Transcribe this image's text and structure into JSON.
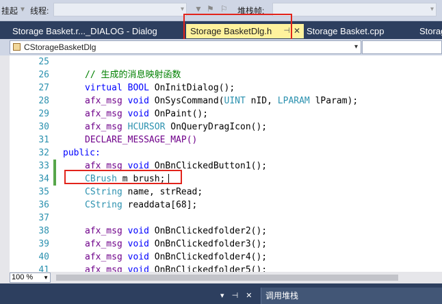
{
  "toolbar": {
    "bookmark_label": "挂起",
    "thread_label": "线程:",
    "stackframe_label": "堆栈帧:"
  },
  "tabs": [
    {
      "label": "Storage Basket.r..._DIALOG - Dialog",
      "active": false
    },
    {
      "label": "Storage BasketDlg.h",
      "active": true
    },
    {
      "label": "Storage Basket.cpp",
      "active": false
    },
    {
      "label": "Storag",
      "active": false
    }
  ],
  "nav": {
    "class_value": "CStorageBasketDlg",
    "member_value": ""
  },
  "code_lines": [
    {
      "n": "25"
    },
    {
      "n": "26",
      "t": "// 生成的消息映射函数"
    },
    {
      "n": "27",
      "t": "virtual BOOL OnInitDialog();"
    },
    {
      "n": "28",
      "t": "afx_msg void OnSysCommand(UINT nID, LPARAM lParam);"
    },
    {
      "n": "29",
      "t": "afx_msg void OnPaint();"
    },
    {
      "n": "30",
      "t": "afx_msg HCURSOR OnQueryDragIcon();"
    },
    {
      "n": "31",
      "t": "DECLARE_MESSAGE_MAP()"
    },
    {
      "n": "32",
      "t": "public:"
    },
    {
      "n": "33",
      "t": "afx_msg void OnBnClickedButton1();"
    },
    {
      "n": "34",
      "t": "CBrush m_brush;"
    },
    {
      "n": "35",
      "t": "CString name, strRead;"
    },
    {
      "n": "36",
      "t": "CString readdata[68];"
    },
    {
      "n": "37"
    },
    {
      "n": "38",
      "t": "afx_msg void OnBnClickedfolder2();"
    },
    {
      "n": "39",
      "t": "afx_msg void OnBnClickedfolder3();"
    },
    {
      "n": "40",
      "t": "afx_msg void OnBnClickedfolder4();"
    },
    {
      "n": "41",
      "t": "afx_msg void OnBnClickedfolder5();"
    }
  ],
  "zoom": "100 %",
  "bottom": {
    "pane_title": "调用堆栈"
  },
  "colors": {
    "keyword": "#0000ff",
    "type": "#2b91af",
    "macro": "#6f008a",
    "comment": "#008000",
    "highlight": "#e2231a",
    "active_tab": "#fff29d"
  }
}
